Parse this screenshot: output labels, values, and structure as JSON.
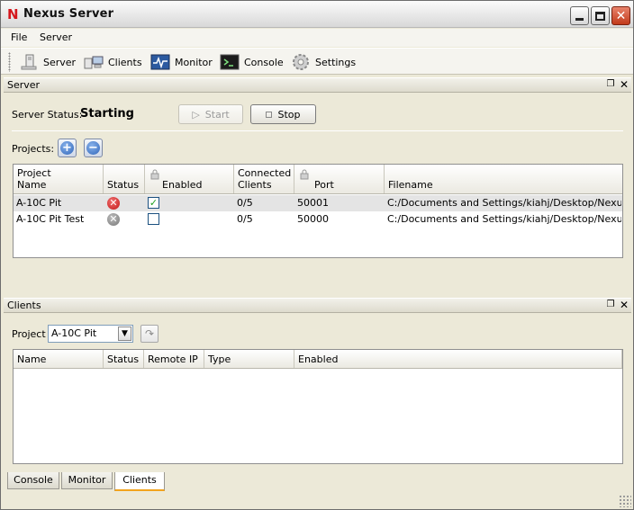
{
  "window": {
    "title": "Nexus Server",
    "app_icon_letter": "N"
  },
  "menu": {
    "items": [
      "File",
      "Server"
    ]
  },
  "toolbar": {
    "buttons": [
      {
        "label": "Server",
        "icon": "server-icon"
      },
      {
        "label": "Clients",
        "icon": "clients-icon"
      },
      {
        "label": "Monitor",
        "icon": "monitor-icon"
      },
      {
        "label": "Console",
        "icon": "console-icon"
      },
      {
        "label": "Settings",
        "icon": "settings-icon"
      }
    ]
  },
  "server_panel": {
    "title": "Server",
    "status_label": "Server Status:",
    "status_value": "Starting",
    "start_label": "Start",
    "stop_label": "Stop",
    "projects_label": "Projects:",
    "columns": [
      "Project\nName",
      "Status",
      "Enabled",
      "Connected\nClients",
      "Port",
      "Filename"
    ],
    "rows": [
      {
        "name": "A-10C Pit",
        "status": "error",
        "enabled": true,
        "clients": "0/5",
        "port": "50001",
        "filename": "C:/Documents and Settings/kiahj/Desktop/NexusSe...",
        "selected": true
      },
      {
        "name": "A-10C Pit Test",
        "status": "off",
        "enabled": false,
        "clients": "0/5",
        "port": "50000",
        "filename": "C:/Documents and Settings/kiahj/Desktop/NexusSe...",
        "selected": false
      }
    ]
  },
  "clients_panel": {
    "title": "Clients",
    "project_label": "Project",
    "project_value": "A-10C Pit",
    "columns": [
      "Name",
      "Status",
      "Remote IP",
      "Type",
      "Enabled"
    ]
  },
  "tabs": [
    {
      "label": "Console",
      "active": false
    },
    {
      "label": "Monitor",
      "active": false
    },
    {
      "label": "Clients",
      "active": true
    }
  ]
}
